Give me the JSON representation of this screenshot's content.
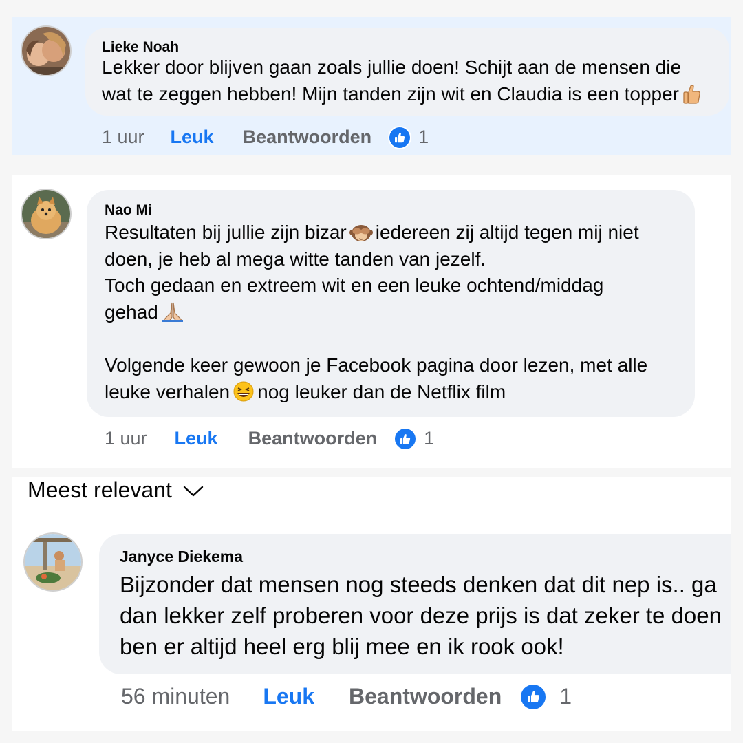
{
  "comments": [
    {
      "author": "Lieke Noah",
      "lines": [
        "Lekker door blijven gaan zoals jullie doen! Schijt aan de mensen die",
        "wat te zeggen hebben! Mijn tanden zijn wit en Claudia is een topper"
      ],
      "time": "1 uur",
      "like_label": "Leuk",
      "reply_label": "Beantwoorden",
      "reaction_count": "1",
      "highlighted": true
    },
    {
      "author": "Nao Mi",
      "lines": [
        "Resultaten bij jullie zijn bizar",
        "iedereen zij altijd tegen mij niet",
        "doen, je heb al mega witte tanden van jezelf.",
        "Toch gedaan en extreem wit en een leuke ochtend/middag",
        "gehad",
        "",
        "Volgende keer gewoon je Facebook pagina door lezen, met alle",
        "leuke verhalen",
        "nog leuker dan de Netflix film"
      ],
      "time": "1 uur",
      "like_label": "Leuk",
      "reply_label": "Beantwoorden",
      "reaction_count": "1"
    },
    {
      "author": "Janyce Diekema",
      "lines": [
        "Bijzonder dat mensen nog steeds denken dat dit nep is.. ga",
        "dan lekker zelf proberen voor deze prijs is dat zeker te doen",
        "ben er altijd heel erg blij mee en ik rook ook!"
      ],
      "time": "56 minuten",
      "like_label": "Leuk",
      "reply_label": "Beantwoorden",
      "reaction_count": "1"
    }
  ],
  "sort": {
    "label": "Meest relevant"
  },
  "icons": {
    "reaction": "like-thumb-icon",
    "emoji_1": "thumbs-up-emoji",
    "emoji_2": "see-no-evil-monkey-emoji",
    "emoji_3": "folded-hands-emoji",
    "emoji_4": "grinning-squinting-face-emoji",
    "sort_chevron": "chevron-down-icon"
  },
  "colors": {
    "accent": "#1877f2",
    "highlight_bg": "#e8f2fe",
    "bubble_bg": "#f0f2f5",
    "meta_text": "#65676b"
  }
}
